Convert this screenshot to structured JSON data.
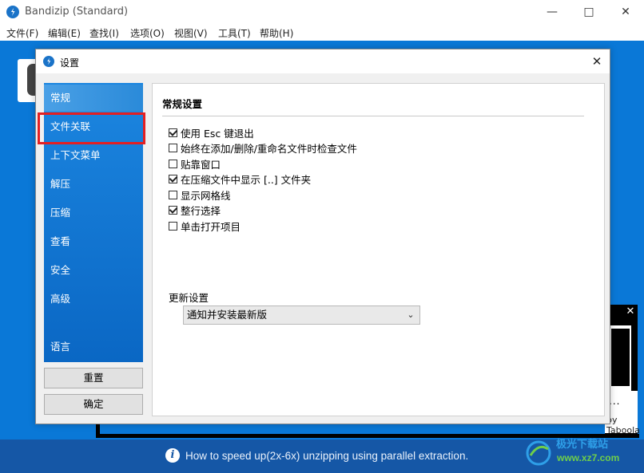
{
  "app": {
    "title": "Bandizip (Standard)",
    "menu": [
      "文件(F)",
      "编辑(E)",
      "查找(I)",
      "选项(O)",
      "视图(V)",
      "工具(T)",
      "帮助(H)"
    ],
    "window_controls": [
      "minimize-icon",
      "maximize-icon",
      "close-icon"
    ]
  },
  "dialog": {
    "title": "设置",
    "sidebar": [
      "常规",
      "文件关联",
      "上下文菜单",
      "解压",
      "压缩",
      "查看",
      "安全",
      "高级",
      "语言"
    ],
    "active_item": "常规",
    "highlighted_item": "文件关联",
    "buttons": {
      "reset": "重置",
      "ok": "确定"
    },
    "panel": {
      "heading": "常规设置",
      "options": [
        {
          "label": "使用 Esc 键退出",
          "checked": true
        },
        {
          "label": "始终在添加/删除/重命名文件时检查文件",
          "checked": false
        },
        {
          "label": "贴靠窗口",
          "checked": false
        },
        {
          "label": "在压缩文件中显示 [..] 文件夹",
          "checked": true
        },
        {
          "label": "显示网格线",
          "checked": false
        },
        {
          "label": "整行选择",
          "checked": true
        },
        {
          "label": "单击打开项目",
          "checked": false
        }
      ],
      "update_label": "更新设置",
      "update_value": "通知并安装最新版"
    }
  },
  "ad": {
    "dots": "...",
    "brand": "by Taboola"
  },
  "status": {
    "text": "How to speed up(2x-6x) unzipping using parallel extraction."
  },
  "watermark": {
    "name": "极光下载站",
    "url": "www.xz7.com"
  },
  "colors": {
    "accent": "#0a78d7",
    "status_bar": "#1557a6",
    "highlight": "#e41f22"
  }
}
